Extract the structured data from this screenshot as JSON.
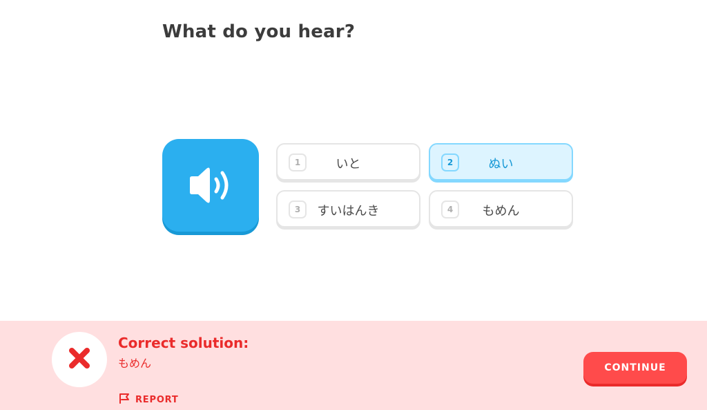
{
  "prompt": {
    "title": "What do you hear?"
  },
  "audio": {
    "icon": "speaker-icon",
    "color": "#2bafef"
  },
  "choices": [
    {
      "number": "1",
      "text": "いと",
      "selected": false
    },
    {
      "number": "2",
      "text": "ぬい",
      "selected": true
    },
    {
      "number": "3",
      "text": "すいはんき",
      "selected": false
    },
    {
      "number": "4",
      "text": "もめん",
      "selected": false
    }
  ],
  "feedback": {
    "status": "incorrect",
    "icon": "x-mark-icon",
    "title": "Correct solution:",
    "answer": "もめん",
    "report_label": "REPORT",
    "report_icon": "flag-icon",
    "continue_label": "CONTINUE",
    "colors": {
      "background": "#ffdfe0",
      "accent": "#ea2b2b",
      "button": "#ff4b4b"
    }
  }
}
